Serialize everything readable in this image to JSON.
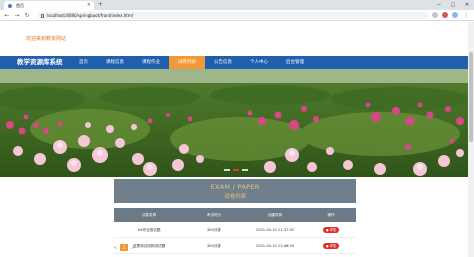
{
  "browser": {
    "tab_title": "首页",
    "url": "localhost:8080/springboot/front/index.html",
    "new_tab": "+",
    "close_tab": "×"
  },
  "page": {
    "welcome_text": "欢迎来到教资网站",
    "brand": "教学资源库系统",
    "menu": [
      {
        "label": "首页",
        "active": false
      },
      {
        "label": "课程信息",
        "active": false
      },
      {
        "label": "课程作业",
        "active": false
      },
      {
        "label": "试卷列表",
        "active": true
      },
      {
        "label": "公告信息",
        "active": false
      },
      {
        "label": "个人中心",
        "active": false
      },
      {
        "label": "后台管理",
        "active": false
      }
    ],
    "section_title_en": "EXAM / PAPER",
    "section_title_cn": "试卷列表",
    "table": {
      "headers": [
        "试卷名称",
        "考试时长",
        "创建时间",
        "操作"
      ],
      "rows": [
        {
          "name": "XX作业测试题",
          "duration": "300分钟",
          "created": "2021-04-10 11:37:32",
          "action": "详情"
        },
        {
          "name": "这是测试用的测试题",
          "duration": "300分钟",
          "created": "2021-04-10 11:46:59",
          "action": "详情"
        }
      ]
    },
    "pager": {
      "prev": "<",
      "current": "1",
      "next": ">"
    }
  },
  "colors": {
    "navbar": "#1f5fad",
    "active_menu": "#f29a3a",
    "welcome": "#e07b24",
    "title_box": "#6f7f8b",
    "table_header": "#6c7a87",
    "detail_button": "#d9302c"
  }
}
